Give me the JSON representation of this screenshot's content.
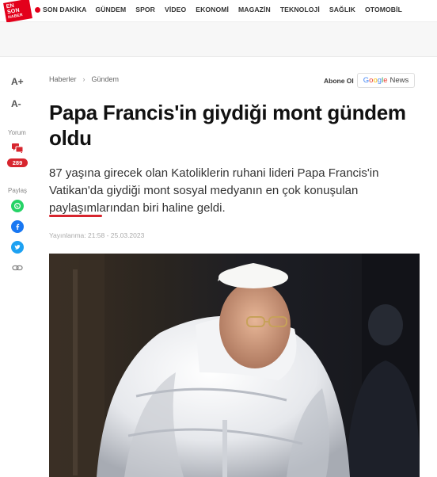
{
  "header": {
    "logo_lines": [
      "EN",
      "SON",
      "HABER"
    ],
    "nav": [
      {
        "label": "SON DAKİKA",
        "live": true
      },
      {
        "label": "GÜNDEM"
      },
      {
        "label": "SPOR"
      },
      {
        "label": "VİDEO"
      },
      {
        "label": "EKONOMİ"
      },
      {
        "label": "MAGAZİN"
      },
      {
        "label": "TEKNOLOJİ"
      },
      {
        "label": "SAĞLIK"
      },
      {
        "label": "OTOMOBİL"
      }
    ]
  },
  "sidebar": {
    "font_increase": "A+",
    "font_decrease": "A-",
    "comments_label": "Yorum",
    "comments_count": "289",
    "share_label": "Paylaş",
    "share_icons": [
      "whatsapp-icon",
      "facebook-icon",
      "twitter-icon",
      "link-icon"
    ]
  },
  "breadcrumb": {
    "items": [
      "Haberler",
      "Gündem"
    ]
  },
  "follow": {
    "label": "Abone Ol",
    "google": "Google",
    "news": "News"
  },
  "article": {
    "headline": "Papa Francis'in giydiği mont gündem oldu",
    "summary": "87 yaşına girecek olan Katoliklerin ruhani lideri Papa Francis'in Vatikan'da giydiği mont sosyal medyanın en çok konuşulan paylaşımlarından biri haline geldi.",
    "published": "Yayınlanma: 21:58 - 25.03.2023"
  },
  "colors": {
    "brand_red": "#e3001b",
    "accent_red": "#d7252e",
    "whatsapp": "#25d366",
    "facebook": "#1877f2",
    "twitter": "#1da1f2"
  }
}
